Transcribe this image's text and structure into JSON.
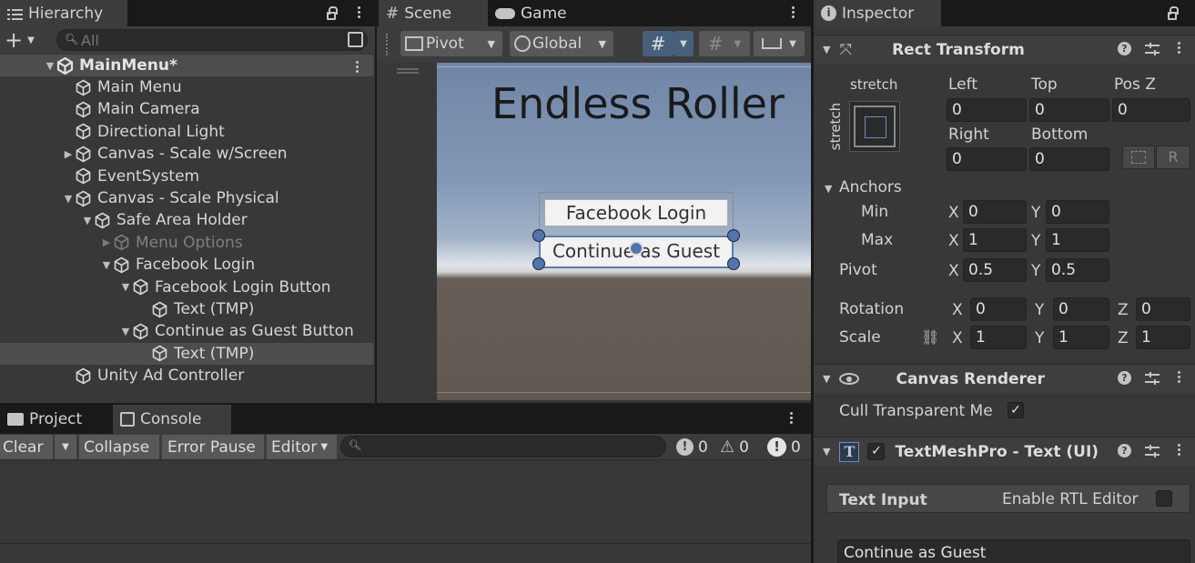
{
  "hierarchy": {
    "tab_label": "Hierarchy",
    "search_placeholder": "All",
    "scene_name": "MainMenu*",
    "items": [
      {
        "label": "Main Menu"
      },
      {
        "label": "Main Camera"
      },
      {
        "label": "Directional Light"
      },
      {
        "label": "Canvas - Scale w/Screen"
      },
      {
        "label": "EventSystem"
      },
      {
        "label": "Canvas - Scale Physical"
      },
      {
        "label": "Safe Area Holder"
      },
      {
        "label": "Menu Options"
      },
      {
        "label": "Facebook Login"
      },
      {
        "label": "Facebook Login Button"
      },
      {
        "label": "Text (TMP)"
      },
      {
        "label": "Continue as Guest Button"
      },
      {
        "label": "Text (TMP)"
      },
      {
        "label": "Unity Ad Controller"
      }
    ]
  },
  "scene": {
    "tab_scene": "Scene",
    "tab_game": "Game",
    "pivot_label": "Pivot",
    "global_label": "Global",
    "title_text": "Endless Roller",
    "button1_text": "Facebook Login",
    "button2_text": "Continue as Guest"
  },
  "console": {
    "tab_project": "Project",
    "tab_console": "Console",
    "clear_label": "Clear",
    "collapse_label": "Collapse",
    "error_pause_label": "Error Pause",
    "editor_label": "Editor",
    "info_count": "0",
    "warn_count": "0",
    "error_count": "0"
  },
  "inspector": {
    "tab_label": "Inspector",
    "rect_transform": {
      "title": "Rect Transform",
      "stretch_top": "stretch",
      "stretch_side": "stretch",
      "left_label": "Left",
      "left_value": "0",
      "top_label": "Top",
      "top_value": "0",
      "posz_label": "Pos Z",
      "posz_value": "0",
      "right_label": "Right",
      "right_value": "0",
      "bottom_label": "Bottom",
      "bottom_value": "0",
      "r_label": "R",
      "anchors_label": "Anchors",
      "min_label": "Min",
      "min_x": "0",
      "min_y": "0",
      "max_label": "Max",
      "max_x": "1",
      "max_y": "1",
      "pivot_label": "Pivot",
      "pivot_x": "0.5",
      "pivot_y": "0.5",
      "rotation_label": "Rotation",
      "rot_x": "0",
      "rot_y": "0",
      "rot_z": "0",
      "scale_label": "Scale",
      "scale_x": "1",
      "scale_y": "1",
      "scale_z": "1",
      "x": "X",
      "y": "Y",
      "z": "Z"
    },
    "canvas_renderer": {
      "title": "Canvas Renderer",
      "cull_label": "Cull Transparent Me"
    },
    "textmeshpro": {
      "title": "TextMeshPro - Text (UI)",
      "text_input_label": "Text Input",
      "rtl_label": "Enable RTL Editor",
      "text_value": "Continue as Guest"
    }
  },
  "colors": {
    "accent": "#46607c",
    "selected_row": "#4d4d4d",
    "panel": "#383838"
  }
}
